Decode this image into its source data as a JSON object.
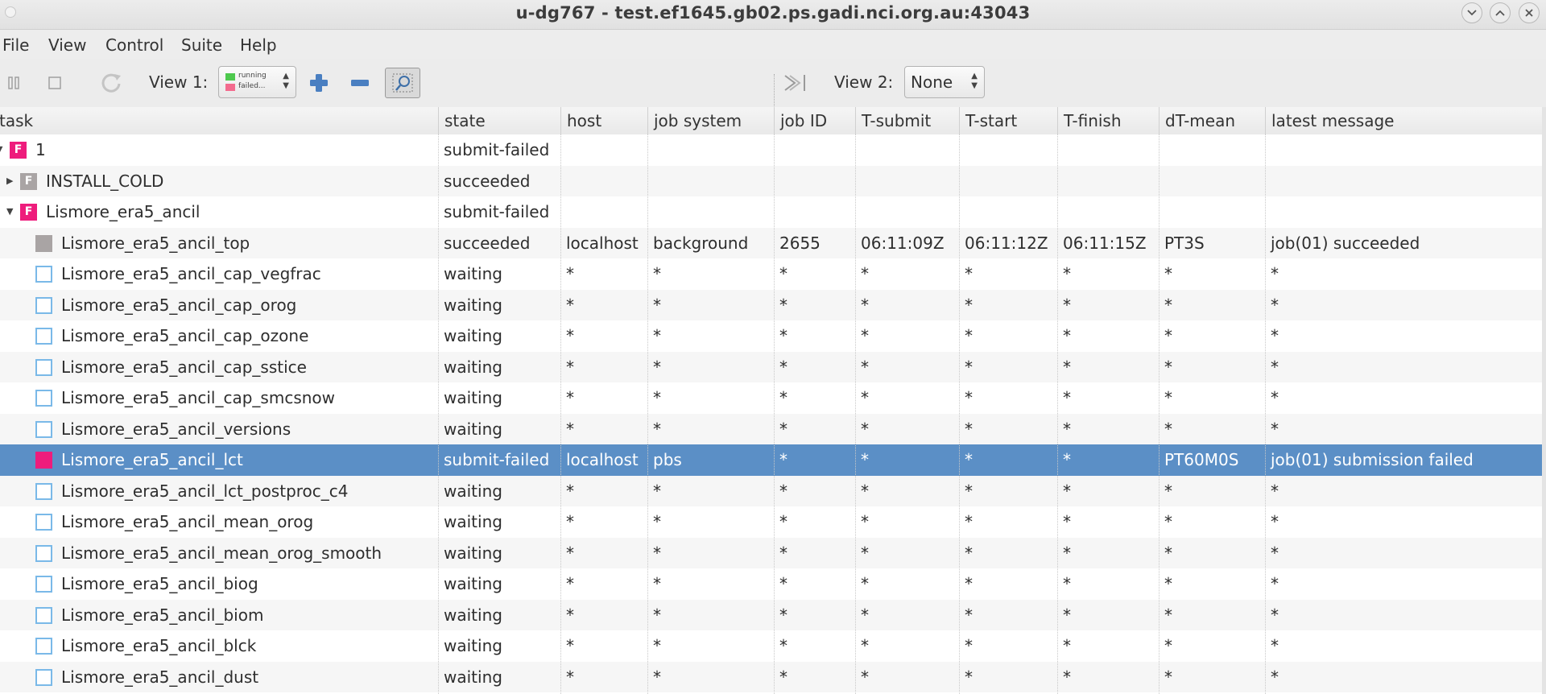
{
  "window": {
    "title": "u-dg767 - test.ef1645.gb02.ps.gadi.nci.org.au:43043"
  },
  "menu": [
    "File",
    "View",
    "Control",
    "Suite",
    "Help"
  ],
  "toolbar": {
    "view1_label": "View 1:",
    "view1_legend": [
      "running",
      "failed..."
    ],
    "view2_label": "View 2:",
    "view2_value": "None"
  },
  "columns": [
    "task",
    "state",
    "host",
    "job system",
    "job ID",
    "T-submit",
    "T-start",
    "T-finish",
    "dT-mean",
    "latest message"
  ],
  "rows": [
    {
      "task": "1",
      "depth": 0,
      "expander": "▼",
      "icon": "F",
      "state": "submit-failed",
      "host": "",
      "job_system": "",
      "job_id": "",
      "t_submit": "",
      "t_start": "",
      "t_finish": "",
      "dt_mean": "",
      "message": ""
    },
    {
      "task": "INSTALL_COLD",
      "depth": 1,
      "expander": "▶",
      "icon": "Fg",
      "state": "succeeded",
      "host": "",
      "job_system": "",
      "job_id": "",
      "t_submit": "",
      "t_start": "",
      "t_finish": "",
      "dt_mean": "",
      "message": ""
    },
    {
      "task": "Lismore_era5_ancil",
      "depth": 1,
      "expander": "▼",
      "icon": "F",
      "state": "submit-failed",
      "host": "",
      "job_system": "",
      "job_id": "",
      "t_submit": "",
      "t_start": "",
      "t_finish": "",
      "dt_mean": "",
      "message": ""
    },
    {
      "task": "Lismore_era5_ancil_top",
      "depth": 2,
      "expander": "",
      "icon": "gray",
      "state": "succeeded",
      "host": "localhost",
      "job_system": "background",
      "job_id": "2655",
      "t_submit": "06:11:09Z",
      "t_start": "06:11:12Z",
      "t_finish": "06:11:15Z",
      "dt_mean": "PT3S",
      "message": "job(01) succeeded"
    },
    {
      "task": "Lismore_era5_ancil_cap_vegfrac",
      "depth": 2,
      "expander": "",
      "icon": "wait",
      "state": "waiting",
      "host": "*",
      "job_system": "*",
      "job_id": "*",
      "t_submit": "*",
      "t_start": "*",
      "t_finish": "*",
      "dt_mean": "*",
      "message": "*"
    },
    {
      "task": "Lismore_era5_ancil_cap_orog",
      "depth": 2,
      "expander": "",
      "icon": "wait",
      "state": "waiting",
      "host": "*",
      "job_system": "*",
      "job_id": "*",
      "t_submit": "*",
      "t_start": "*",
      "t_finish": "*",
      "dt_mean": "*",
      "message": "*"
    },
    {
      "task": "Lismore_era5_ancil_cap_ozone",
      "depth": 2,
      "expander": "",
      "icon": "wait",
      "state": "waiting",
      "host": "*",
      "job_system": "*",
      "job_id": "*",
      "t_submit": "*",
      "t_start": "*",
      "t_finish": "*",
      "dt_mean": "*",
      "message": "*"
    },
    {
      "task": "Lismore_era5_ancil_cap_sstice",
      "depth": 2,
      "expander": "",
      "icon": "wait",
      "state": "waiting",
      "host": "*",
      "job_system": "*",
      "job_id": "*",
      "t_submit": "*",
      "t_start": "*",
      "t_finish": "*",
      "dt_mean": "*",
      "message": "*"
    },
    {
      "task": "Lismore_era5_ancil_cap_smcsnow",
      "depth": 2,
      "expander": "",
      "icon": "wait",
      "state": "waiting",
      "host": "*",
      "job_system": "*",
      "job_id": "*",
      "t_submit": "*",
      "t_start": "*",
      "t_finish": "*",
      "dt_mean": "*",
      "message": "*"
    },
    {
      "task": "Lismore_era5_ancil_versions",
      "depth": 2,
      "expander": "",
      "icon": "wait",
      "state": "waiting",
      "host": "*",
      "job_system": "*",
      "job_id": "*",
      "t_submit": "*",
      "t_start": "*",
      "t_finish": "*",
      "dt_mean": "*",
      "message": "*"
    },
    {
      "task": "Lismore_era5_ancil_lct",
      "depth": 2,
      "expander": "",
      "icon": "pink",
      "selected": true,
      "state": "submit-failed",
      "host": "localhost",
      "job_system": "pbs",
      "job_id": "*",
      "t_submit": "*",
      "t_start": "*",
      "t_finish": "*",
      "dt_mean": "PT60M0S",
      "message": "job(01) submission failed"
    },
    {
      "task": "Lismore_era5_ancil_lct_postproc_c4",
      "depth": 2,
      "expander": "",
      "icon": "wait",
      "state": "waiting",
      "host": "*",
      "job_system": "*",
      "job_id": "*",
      "t_submit": "*",
      "t_start": "*",
      "t_finish": "*",
      "dt_mean": "*",
      "message": "*"
    },
    {
      "task": "Lismore_era5_ancil_mean_orog",
      "depth": 2,
      "expander": "",
      "icon": "wait",
      "state": "waiting",
      "host": "*",
      "job_system": "*",
      "job_id": "*",
      "t_submit": "*",
      "t_start": "*",
      "t_finish": "*",
      "dt_mean": "*",
      "message": "*"
    },
    {
      "task": "Lismore_era5_ancil_mean_orog_smooth",
      "depth": 2,
      "expander": "",
      "icon": "wait",
      "state": "waiting",
      "host": "*",
      "job_system": "*",
      "job_id": "*",
      "t_submit": "*",
      "t_start": "*",
      "t_finish": "*",
      "dt_mean": "*",
      "message": "*"
    },
    {
      "task": "Lismore_era5_ancil_biog",
      "depth": 2,
      "expander": "",
      "icon": "wait",
      "state": "waiting",
      "host": "*",
      "job_system": "*",
      "job_id": "*",
      "t_submit": "*",
      "t_start": "*",
      "t_finish": "*",
      "dt_mean": "*",
      "message": "*"
    },
    {
      "task": "Lismore_era5_ancil_biom",
      "depth": 2,
      "expander": "",
      "icon": "wait",
      "state": "waiting",
      "host": "*",
      "job_system": "*",
      "job_id": "*",
      "t_submit": "*",
      "t_start": "*",
      "t_finish": "*",
      "dt_mean": "*",
      "message": "*"
    },
    {
      "task": "Lismore_era5_ancil_blck",
      "depth": 2,
      "expander": "",
      "icon": "wait",
      "state": "waiting",
      "host": "*",
      "job_system": "*",
      "job_id": "*",
      "t_submit": "*",
      "t_start": "*",
      "t_finish": "*",
      "dt_mean": "*",
      "message": "*"
    },
    {
      "task": "Lismore_era5_ancil_dust",
      "depth": 2,
      "expander": "",
      "icon": "wait",
      "state": "waiting",
      "host": "*",
      "job_system": "*",
      "job_id": "*",
      "t_submit": "*",
      "t_start": "*",
      "t_finish": "*",
      "dt_mean": "*",
      "message": "*"
    }
  ]
}
